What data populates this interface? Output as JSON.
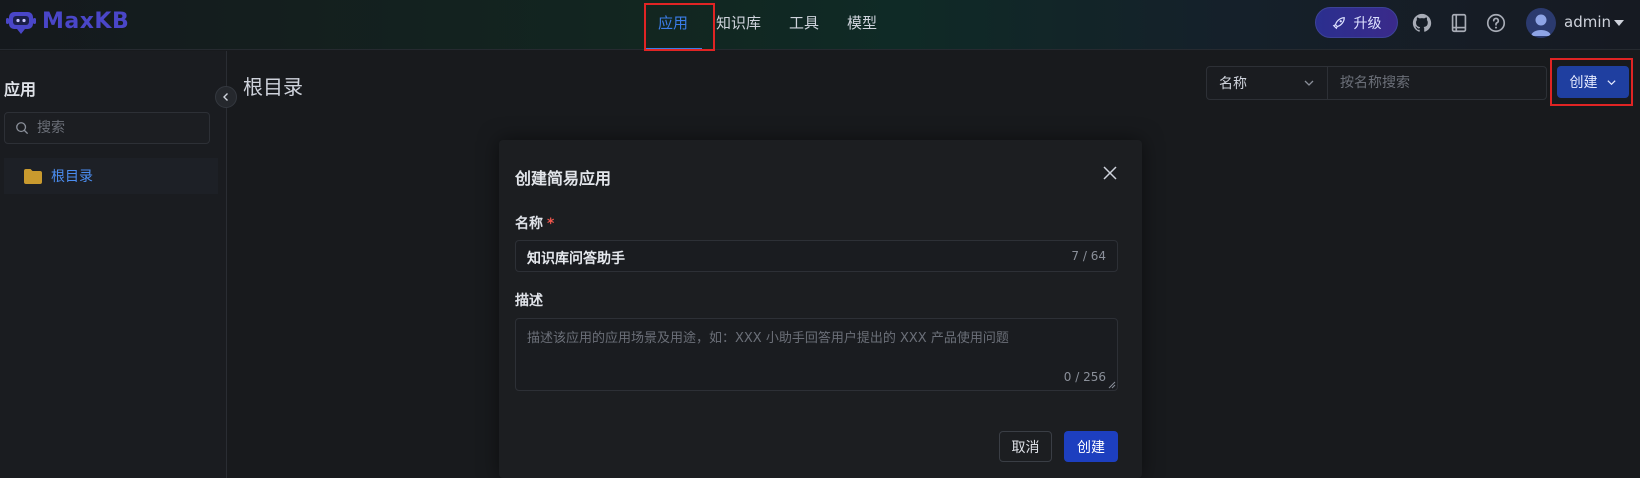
{
  "header": {
    "logo_text": "MaxKB",
    "nav": [
      {
        "label": "应用",
        "active": true
      },
      {
        "label": "知识库",
        "active": false
      },
      {
        "label": "工具",
        "active": false
      },
      {
        "label": "模型",
        "active": false
      }
    ],
    "upgrade_label": "升级",
    "icons": [
      "github-icon",
      "book-icon",
      "help-icon"
    ],
    "username": "admin"
  },
  "sidebar": {
    "title": "应用",
    "search_placeholder": "搜索",
    "folder_label": "根目录"
  },
  "main": {
    "title": "根目录",
    "filter_select": "名称",
    "filter_placeholder": "按名称搜索",
    "create_label": "创建"
  },
  "dialog": {
    "title": "创建简易应用",
    "name_label": "名称",
    "required_mark": "*",
    "name_value": "知识库问答助手",
    "name_count": "7 / 64",
    "desc_label": "描述",
    "desc_placeholder": "描述该应用的应用场景及用途，如：XXX 小助手回答用户提出的 XXX 产品使用问题",
    "desc_count": "0 / 256",
    "cancel_label": "取消",
    "create_label": "创建"
  },
  "colors": {
    "accent": "#3b7de8",
    "primary_button": "#1d3fbf",
    "highlight_box": "#e02424"
  }
}
